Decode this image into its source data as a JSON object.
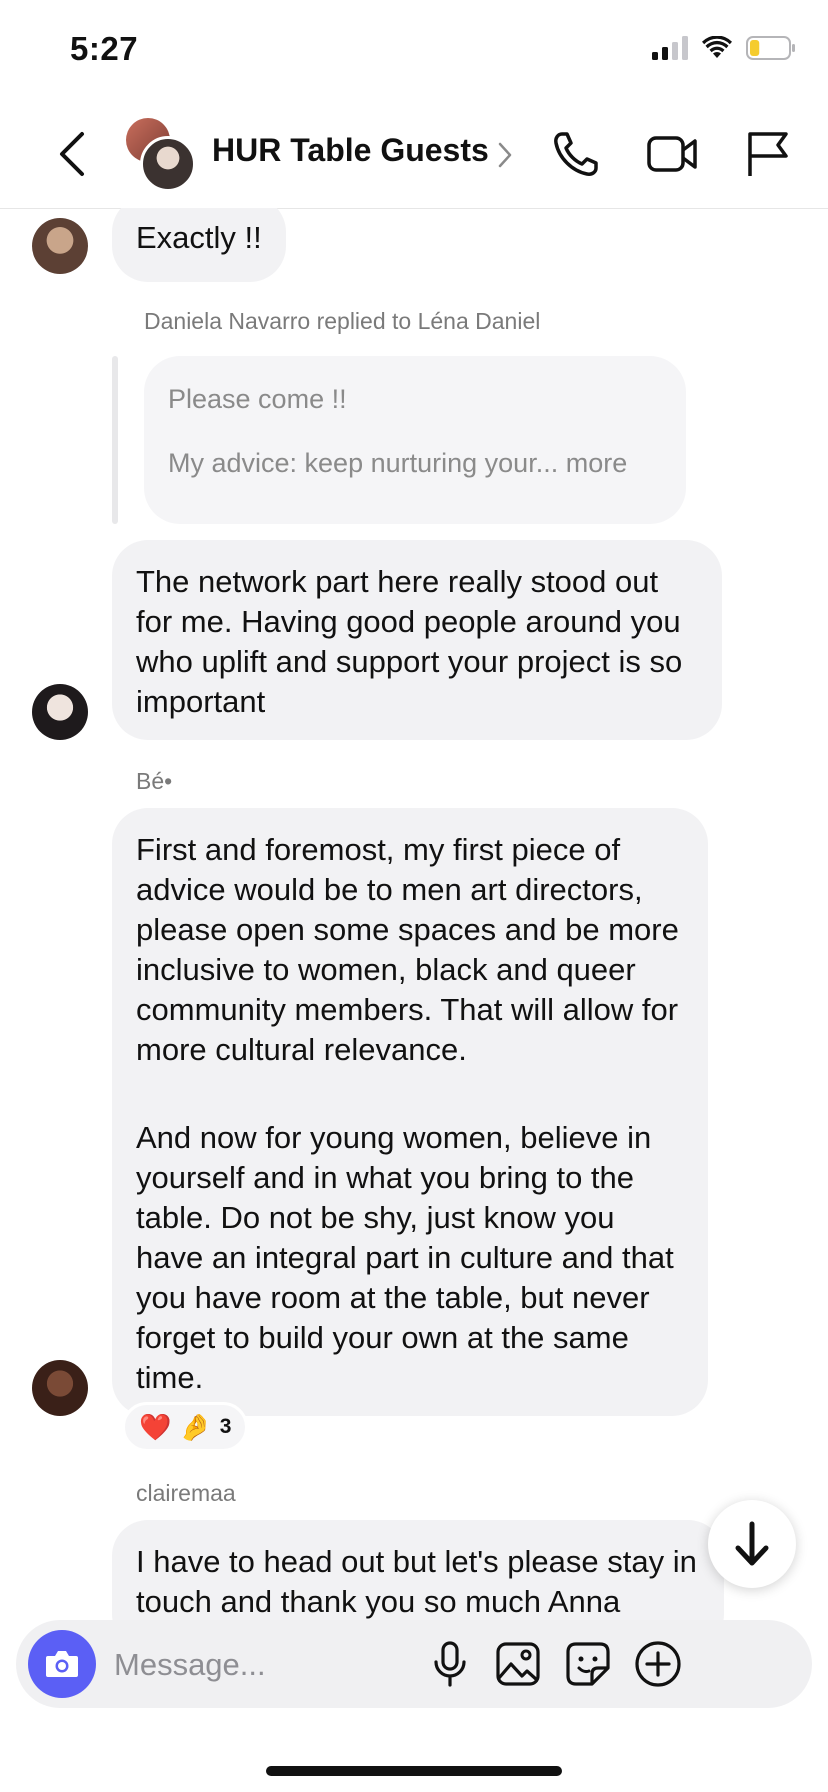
{
  "status_bar": {
    "time": "5:27",
    "battery_level": 0.25,
    "battery_color": "#f5cc2e"
  },
  "header": {
    "title": "HUR Table Guests",
    "icons": [
      "back-chevron-icon",
      "chevron-right-icon",
      "phone-icon",
      "video-camera-icon",
      "flag-icon"
    ]
  },
  "messages": {
    "m1": {
      "text": "Exactly !!"
    },
    "reply": {
      "label": "Daniela Navarro replied to Léna Daniel",
      "quote_line1": "Please come !!",
      "quote_line2": "My advice: keep nurturing your... more"
    },
    "m2": {
      "text": "The network part here really stood out for me. Having good people around you who uplift and support your project is so important"
    },
    "m3": {
      "sender": "Bé•",
      "para1": "First and foremost, my first piece of advice would be to men art directors, please open some spaces and be more inclusive to women, black and queer community members. That will allow for more cultural relevance.",
      "para2": "And now for young women, believe in yourself and in what you bring to the table. Do not be shy, just know you have an integral part in culture and that you have room at the table, but never forget to build your own at the same time.",
      "reactions": {
        "emoji1": "❤️",
        "emoji2": "🤌",
        "count": "3"
      }
    },
    "m4": {
      "sender": "clairemaa",
      "text": "I have to head out but let's please stay in touch and thank you so much Anna"
    }
  },
  "composer": {
    "placeholder": "Message...",
    "accent_color": "#5b5ff5",
    "icons": [
      "camera-icon",
      "microphone-icon",
      "image-icon",
      "sticker-icon",
      "plus-circle-icon"
    ]
  }
}
